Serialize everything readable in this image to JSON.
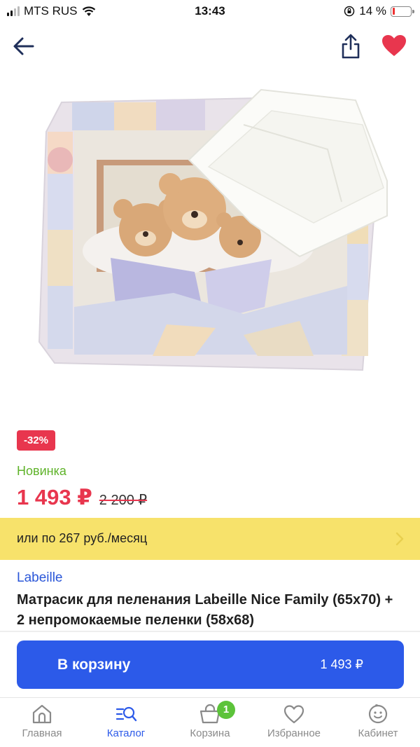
{
  "status_bar": {
    "carrier": "MTS RUS",
    "time": "13:43",
    "battery_percent": "14 %",
    "battery_level": 0.14
  },
  "nav": {
    "back_icon": "arrow-left-icon",
    "share_icon": "share-icon",
    "favorite_icon": "heart-icon",
    "favorite_color": "#e8364e"
  },
  "product": {
    "image_alt": "product-photo",
    "discount": "-32%",
    "new_label": "Новинка",
    "price": "1 493 ₽",
    "old_price": "2 200 ₽",
    "installment": "или по 267 руб./месяц",
    "brand": "Labeille",
    "title": "Матрасик для пеленания Labeille Nice Family (65x70) + 2 непромокаемые пеленки (58x68)"
  },
  "cart_button": {
    "label": "В корзину",
    "price": "1 493 ₽"
  },
  "tabs": [
    {
      "label": "Главная",
      "icon": "home-icon",
      "active": false
    },
    {
      "label": "Каталог",
      "icon": "catalog-search-icon",
      "active": true
    },
    {
      "label": "Корзина",
      "icon": "basket-icon",
      "active": false,
      "badge": "1"
    },
    {
      "label": "Избранное",
      "icon": "heart-outline-icon",
      "active": false
    },
    {
      "label": "Кабинет",
      "icon": "smiley-icon",
      "active": false
    }
  ],
  "colors": {
    "accent_blue": "#2c5ae9",
    "price_red": "#e8364e",
    "new_green": "#5fb32a",
    "installment_yellow": "#f7e26b"
  }
}
